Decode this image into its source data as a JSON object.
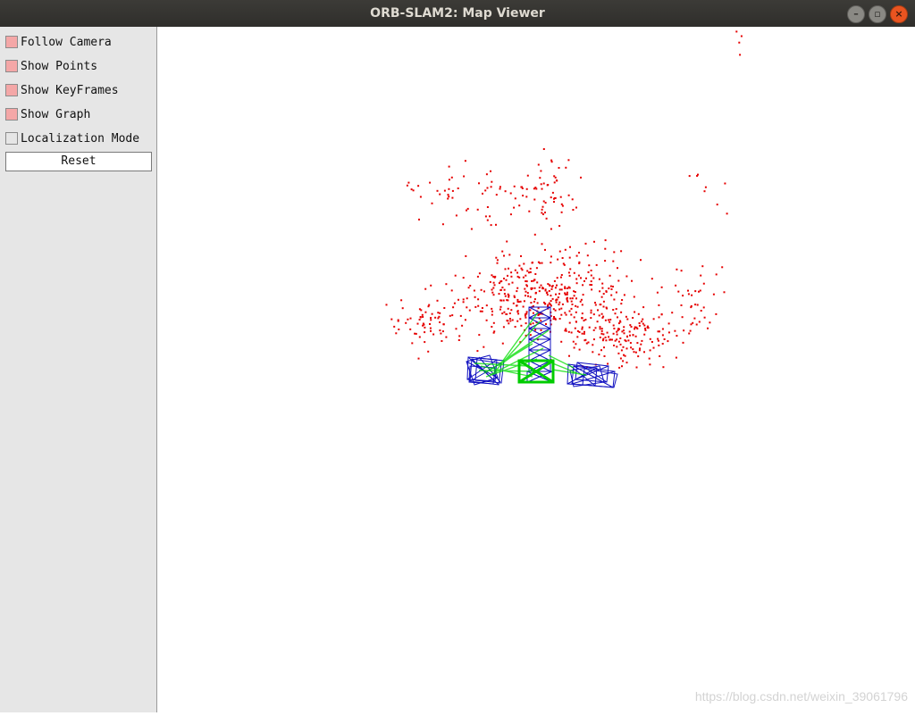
{
  "window": {
    "title": "ORB-SLAM2: Map Viewer",
    "buttons": [
      {
        "icon": "minimize-icon",
        "glyph": "–"
      },
      {
        "icon": "maximize-icon",
        "glyph": "▫"
      },
      {
        "icon": "close-icon",
        "glyph": "×"
      }
    ]
  },
  "panel": {
    "options": [
      {
        "label": "Follow Camera",
        "checked": true
      },
      {
        "label": "Show Points",
        "checked": true
      },
      {
        "label": "Show KeyFrames",
        "checked": true
      },
      {
        "label": "Show Graph",
        "checked": true
      },
      {
        "label": "Localization Mode",
        "checked": false
      }
    ],
    "reset_label": "Reset",
    "checked_color": "#f4a7a7",
    "unchecked_color": "#e6e6e6"
  },
  "viewer": {
    "point_color": "#e60000",
    "keyframe_color": "#1010c0",
    "graph_color": "#00dd00",
    "current_camera_color": "#00cc00"
  },
  "watermark": "https://blog.csdn.net/weixin_39061796"
}
